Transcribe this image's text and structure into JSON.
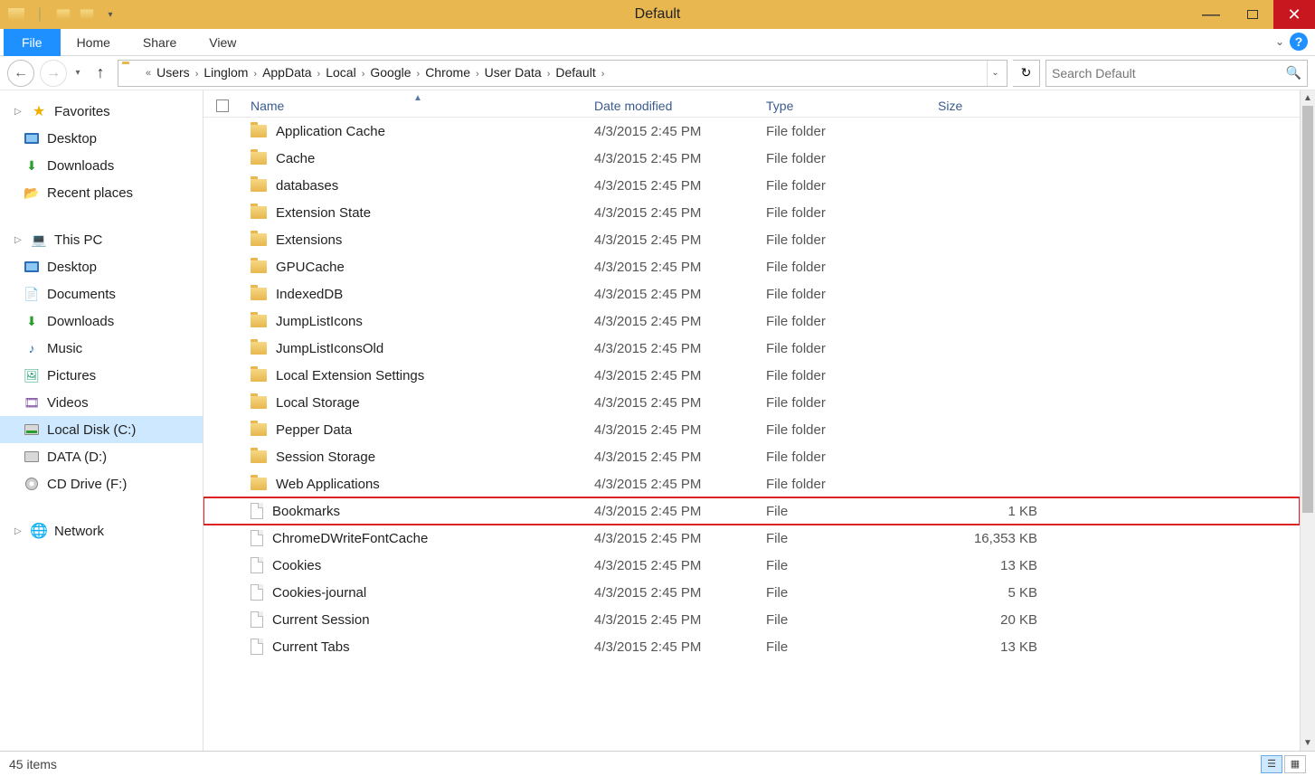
{
  "window": {
    "title": "Default"
  },
  "ribbon": {
    "file": "File",
    "tabs": [
      "Home",
      "Share",
      "View"
    ]
  },
  "breadcrumb": {
    "overflow": "«",
    "items": [
      "Users",
      "Linglom",
      "AppData",
      "Local",
      "Google",
      "Chrome",
      "User Data",
      "Default"
    ]
  },
  "search": {
    "placeholder": "Search Default"
  },
  "nav": {
    "favorites": {
      "label": "Favorites",
      "items": [
        "Desktop",
        "Downloads",
        "Recent places"
      ]
    },
    "thispc": {
      "label": "This PC",
      "items": [
        "Desktop",
        "Documents",
        "Downloads",
        "Music",
        "Pictures",
        "Videos",
        "Local Disk (C:)",
        "DATA (D:)",
        "CD Drive (F:)"
      ],
      "selected_index": 6
    },
    "network": {
      "label": "Network"
    }
  },
  "columns": {
    "name": "Name",
    "date": "Date modified",
    "type": "Type",
    "size": "Size"
  },
  "files": [
    {
      "name": "Application Cache",
      "date": "4/3/2015 2:45 PM",
      "type": "File folder",
      "size": "",
      "icon": "folder"
    },
    {
      "name": "Cache",
      "date": "4/3/2015 2:45 PM",
      "type": "File folder",
      "size": "",
      "icon": "folder"
    },
    {
      "name": "databases",
      "date": "4/3/2015 2:45 PM",
      "type": "File folder",
      "size": "",
      "icon": "folder"
    },
    {
      "name": "Extension State",
      "date": "4/3/2015 2:45 PM",
      "type": "File folder",
      "size": "",
      "icon": "folder"
    },
    {
      "name": "Extensions",
      "date": "4/3/2015 2:45 PM",
      "type": "File folder",
      "size": "",
      "icon": "folder"
    },
    {
      "name": "GPUCache",
      "date": "4/3/2015 2:45 PM",
      "type": "File folder",
      "size": "",
      "icon": "folder"
    },
    {
      "name": "IndexedDB",
      "date": "4/3/2015 2:45 PM",
      "type": "File folder",
      "size": "",
      "icon": "folder"
    },
    {
      "name": "JumpListIcons",
      "date": "4/3/2015 2:45 PM",
      "type": "File folder",
      "size": "",
      "icon": "folder"
    },
    {
      "name": "JumpListIconsOld",
      "date": "4/3/2015 2:45 PM",
      "type": "File folder",
      "size": "",
      "icon": "folder"
    },
    {
      "name": "Local Extension Settings",
      "date": "4/3/2015 2:45 PM",
      "type": "File folder",
      "size": "",
      "icon": "folder"
    },
    {
      "name": "Local Storage",
      "date": "4/3/2015 2:45 PM",
      "type": "File folder",
      "size": "",
      "icon": "folder"
    },
    {
      "name": "Pepper Data",
      "date": "4/3/2015 2:45 PM",
      "type": "File folder",
      "size": "",
      "icon": "folder"
    },
    {
      "name": "Session Storage",
      "date": "4/3/2015 2:45 PM",
      "type": "File folder",
      "size": "",
      "icon": "folder"
    },
    {
      "name": "Web Applications",
      "date": "4/3/2015 2:45 PM",
      "type": "File folder",
      "size": "",
      "icon": "folder"
    },
    {
      "name": "Bookmarks",
      "date": "4/3/2015 2:45 PM",
      "type": "File",
      "size": "1 KB",
      "icon": "file",
      "highlighted": true
    },
    {
      "name": "ChromeDWriteFontCache",
      "date": "4/3/2015 2:45 PM",
      "type": "File",
      "size": "16,353 KB",
      "icon": "file"
    },
    {
      "name": "Cookies",
      "date": "4/3/2015 2:45 PM",
      "type": "File",
      "size": "13 KB",
      "icon": "file"
    },
    {
      "name": "Cookies-journal",
      "date": "4/3/2015 2:45 PM",
      "type": "File",
      "size": "5 KB",
      "icon": "file"
    },
    {
      "name": "Current Session",
      "date": "4/3/2015 2:45 PM",
      "type": "File",
      "size": "20 KB",
      "icon": "file"
    },
    {
      "name": "Current Tabs",
      "date": "4/3/2015 2:45 PM",
      "type": "File",
      "size": "13 KB",
      "icon": "file"
    }
  ],
  "status": {
    "count": "45 items"
  }
}
